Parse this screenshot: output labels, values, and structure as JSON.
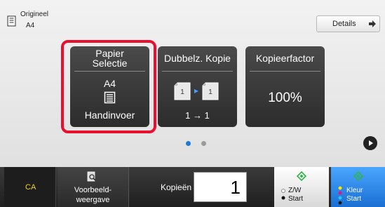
{
  "header": {
    "original_label": "Origineel",
    "original_size": "A4",
    "details_label": "Details"
  },
  "tiles": [
    {
      "title_line1": "Papier",
      "title_line2": "Selectie",
      "size": "A4",
      "source": "Handinvoer",
      "selected": true
    },
    {
      "title": "Dubbelz. Kopie",
      "mode": "1 → 1"
    },
    {
      "title": "Kopieerfactor",
      "value": "100%"
    }
  ],
  "pager": {
    "pages": 2,
    "current": 1
  },
  "footer": {
    "ca_label": "CA",
    "preview_line1": "Voorbeeld-",
    "preview_line2": "weergave",
    "copies_label": "Kopieën",
    "copies_value": "1",
    "start_bw_line1": "Z/W",
    "start_bw_line2": "Start",
    "start_color_line1": "Kleur",
    "start_color_line2": "Start"
  },
  "colors": {
    "highlight": "#e8102e",
    "active_dot": "#1f78d6",
    "ca_text": "#f0d020",
    "start_color": "#1b6fd2",
    "start_diamond": "#2fb54a"
  },
  "icons": {
    "original": "document-icon",
    "details": "arrow-right-icon",
    "tray": "paper-tray-icon",
    "duplex": "duplex-copy-icon",
    "preview": "magnify-document-icon",
    "start": "start-diamond-icon",
    "next": "next-page-icon"
  }
}
